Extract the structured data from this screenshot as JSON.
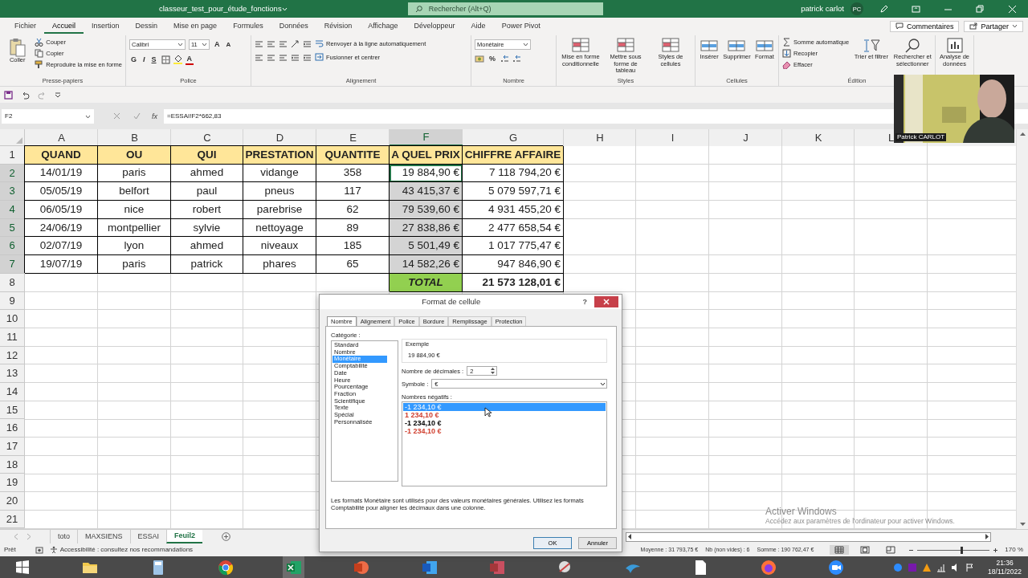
{
  "title_bar": {
    "file_name": "classeur_test_pour_étude_fonctions",
    "search_placeholder": "Rechercher (Alt+Q)",
    "user_name": "patrick carlot",
    "user_initials": "PC"
  },
  "menu_tabs": [
    {
      "label": "Fichier",
      "selected": false
    },
    {
      "label": "Accueil",
      "selected": true
    },
    {
      "label": "Insertion",
      "selected": false
    },
    {
      "label": "Dessin",
      "selected": false
    },
    {
      "label": "Mise en page",
      "selected": false
    },
    {
      "label": "Formules",
      "selected": false
    },
    {
      "label": "Données",
      "selected": false
    },
    {
      "label": "Révision",
      "selected": false
    },
    {
      "label": "Affichage",
      "selected": false
    },
    {
      "label": "Développeur",
      "selected": false
    },
    {
      "label": "Aide",
      "selected": false
    },
    {
      "label": "Power Pivot",
      "selected": false
    }
  ],
  "comments_button": "Commentaires",
  "share_button": "Partager",
  "ribbon_groups": [
    {
      "label": "Presse-papiers",
      "items": [
        {
          "kind": "paste",
          "label": "Coller"
        },
        {
          "kind": "stack",
          "items": [
            {
              "kind": "cut",
              "label": "Couper"
            },
            {
              "kind": "copy",
              "label": "Copier"
            },
            {
              "kind": "painter",
              "label": "Reproduire la mise en forme"
            }
          ]
        }
      ]
    },
    {
      "label": "Police",
      "lines": [
        {
          "items": [
            {
              "kind": "field",
              "value": "Calibri"
            },
            {
              "kind": "field",
              "value": "11"
            },
            {
              "kind": "grow",
              "label": "A"
            },
            {
              "kind": "shrink",
              "label": "A"
            }
          ]
        },
        {
          "items": [
            {
              "kind": "bold",
              "label": "G"
            },
            {
              "kind": "italic",
              "label": "I"
            },
            {
              "kind": "underline",
              "label": "S"
            },
            {
              "kind": "border"
            },
            {
              "kind": "fill"
            },
            {
              "kind": "font_color",
              "label": "A"
            }
          ]
        }
      ]
    },
    {
      "label": "Alignement",
      "lines": [
        {
          "items": [
            {
              "kind": "align"
            },
            {
              "kind": "align"
            },
            {
              "kind": "align"
            },
            {
              "kind": "orient"
            },
            {
              "kind": "indent"
            },
            {
              "kind": "wrap",
              "label": "Renvoyer à la ligne automatiquement"
            }
          ]
        },
        {
          "items": [
            {
              "kind": "align"
            },
            {
              "kind": "align"
            },
            {
              "kind": "align"
            },
            {
              "kind": "indent"
            },
            {
              "kind": "indent"
            },
            {
              "kind": "merge",
              "label": "Fusionner et centrer"
            }
          ]
        }
      ]
    },
    {
      "label": "Nombre",
      "lines": [
        {
          "items": [
            {
              "kind": "field",
              "value": "Monétaire"
            }
          ]
        },
        {
          "items": [
            {
              "kind": "accounting"
            },
            {
              "kind": "percent",
              "label": "%"
            },
            {
              "kind": "decimal"
            },
            {
              "kind": "decimal"
            }
          ]
        }
      ]
    },
    {
      "label": "Styles",
      "items": [
        {
          "kind": "style",
          "label": "Mise en forme conditionnelle"
        },
        {
          "kind": "style",
          "label": "Mettre sous forme de tableau"
        },
        {
          "kind": "style",
          "label": "Styles de cellules"
        }
      ]
    },
    {
      "label": "Cellules",
      "items": [
        {
          "kind": "cells",
          "label": "Insérer"
        },
        {
          "kind": "cells",
          "label": "Supprimer"
        },
        {
          "kind": "cells",
          "label": "Format"
        }
      ]
    },
    {
      "label": "Édition",
      "items": [
        {
          "kind": "stack",
          "items": [
            {
              "kind": "sum",
              "label": "Somme automatique"
            },
            {
              "kind": "filldown",
              "label": "Recopier"
            },
            {
              "kind": "clear",
              "label": "Effacer"
            }
          ]
        },
        {
          "kind": "sort",
          "label": "Trier et filtrer"
        },
        {
          "kind": "find",
          "label": "Rechercher et sélectionner"
        }
      ]
    },
    {
      "items": [
        {
          "kind": "analyze",
          "label": "Analyse de données"
        }
      ]
    }
  ],
  "name_box": "F2",
  "formula_label": "fx",
  "formula": "=ESSAI!F2*662,83",
  "sheet": {
    "columns": [
      {
        "label": "A",
        "selected": false
      },
      {
        "label": "B",
        "selected": false
      },
      {
        "label": "C",
        "selected": false
      },
      {
        "label": "D",
        "selected": false
      },
      {
        "label": "E",
        "selected": false
      },
      {
        "label": "F",
        "selected": true
      },
      {
        "label": "G",
        "selected": false
      },
      {
        "label": "H",
        "selected": false
      },
      {
        "label": "I",
        "selected": false
      },
      {
        "label": "J",
        "selected": false
      },
      {
        "label": "K",
        "selected": false
      },
      {
        "label": "L",
        "selected": false
      }
    ],
    "rows": [
      {
        "number": "1",
        "kind": "header",
        "selected": false,
        "cells": [
          "QUAND",
          "OU",
          "QUI",
          "PRESTATION",
          "QUANTITE",
          "A QUEL PRIX",
          "CHIFFRE AFFAIRE"
        ]
      },
      {
        "number": "2",
        "kind": "data",
        "selected": true,
        "cells": [
          "14/01/19",
          "paris",
          "ahmed",
          "vidange",
          "358",
          "19 884,90 €",
          "7 118 794,20 €"
        ]
      },
      {
        "number": "3",
        "kind": "data",
        "selected": true,
        "cells": [
          "05/05/19",
          "belfort",
          "paul",
          "pneus",
          "117",
          "43 415,37 €",
          "5 079 597,71 €"
        ]
      },
      {
        "number": "4",
        "kind": "data",
        "selected": true,
        "cells": [
          "06/05/19",
          "nice",
          "robert",
          "parebrise",
          "62",
          "79 539,60 €",
          "4 931 455,20 €"
        ]
      },
      {
        "number": "5",
        "kind": "data",
        "selected": true,
        "cells": [
          "24/06/19",
          "montpellier",
          "sylvie",
          "nettoyage",
          "89",
          "27 838,86 €",
          "2 477 658,54 €"
        ]
      },
      {
        "number": "6",
        "kind": "data",
        "selected": true,
        "cells": [
          "02/07/19",
          "lyon",
          "ahmed",
          "niveaux",
          "185",
          "5 501,49 €",
          "1 017 775,47 €"
        ]
      },
      {
        "number": "7",
        "kind": "data",
        "selected": true,
        "cells": [
          "19/07/19",
          "paris",
          "patrick",
          "phares",
          "65",
          "14 582,26 €",
          "947 846,90 €"
        ]
      },
      {
        "number": "8",
        "kind": "total",
        "selected": false,
        "label": "TOTAL",
        "value": "21 573 128,01 €"
      },
      {
        "number": "9",
        "kind": "empty",
        "selected": false
      },
      {
        "number": "10",
        "kind": "empty",
        "selected": false
      },
      {
        "number": "11",
        "kind": "empty",
        "selected": false
      },
      {
        "number": "12",
        "kind": "empty",
        "selected": false
      },
      {
        "number": "13",
        "kind": "empty",
        "selected": false
      },
      {
        "number": "14",
        "kind": "empty",
        "selected": false
      },
      {
        "number": "15",
        "kind": "empty",
        "selected": false
      },
      {
        "number": "16",
        "kind": "empty",
        "selected": false
      },
      {
        "number": "17",
        "kind": "empty",
        "selected": false
      },
      {
        "number": "18",
        "kind": "empty",
        "selected": false
      },
      {
        "number": "19",
        "kind": "empty",
        "selected": false
      },
      {
        "number": "20",
        "kind": "empty",
        "selected": false
      },
      {
        "number": "21",
        "kind": "empty",
        "selected": false
      }
    ]
  },
  "dialog": {
    "title": "Format de cellule",
    "help": "?",
    "tabs": [
      {
        "label": "Nombre",
        "selected": true
      },
      {
        "label": "Alignement",
        "selected": false
      },
      {
        "label": "Police",
        "selected": false
      },
      {
        "label": "Bordure",
        "selected": false
      },
      {
        "label": "Remplissage",
        "selected": false
      },
      {
        "label": "Protection",
        "selected": false
      }
    ],
    "category_label": "Catégorie :",
    "categories": [
      {
        "label": "Standard",
        "selected": false
      },
      {
        "label": "Nombre",
        "selected": false
      },
      {
        "label": "Monétaire",
        "selected": true
      },
      {
        "label": "Comptabilité",
        "selected": false
      },
      {
        "label": "Date",
        "selected": false
      },
      {
        "label": "Heure",
        "selected": false
      },
      {
        "label": "Pourcentage",
        "selected": false
      },
      {
        "label": "Fraction",
        "selected": false
      },
      {
        "label": "Scientifique",
        "selected": false
      },
      {
        "label": "Texte",
        "selected": false
      },
      {
        "label": "Spécial",
        "selected": false
      },
      {
        "label": "Personnalisée",
        "selected": false
      }
    ],
    "sample_label": "Exemple",
    "sample": "19 884,90 €",
    "decimals_label": "Nombre de décimales :",
    "decimals": "2",
    "symbol_label": "Symbole :",
    "symbol": "€",
    "negatives_label": "Nombres négatifs :",
    "negatives": [
      {
        "label": "-1 234,10 €",
        "selected": true
      },
      {
        "label": "1 234,10 €",
        "color": "#d04030",
        "selected": false
      },
      {
        "label": "-1 234,10 €",
        "color": "#000000",
        "selected": false
      },
      {
        "label": "-1 234,10 €",
        "color": "#d04030",
        "selected": false
      }
    ],
    "description": "Les formats Monétaire sont utilisés pour des valeurs monétaires générales. Utilisez les formats Comptabilité pour aligner les décimaux dans une colonne.",
    "buttons": [
      {
        "label": "OK",
        "kind": "confirm"
      },
      {
        "label": "Annuler",
        "kind": "cancel"
      }
    ]
  },
  "sheet_tabs": [
    {
      "label": "toto",
      "selected": false
    },
    {
      "label": "MAXSIENS",
      "selected": false
    },
    {
      "label": "ESSAI",
      "selected": false
    },
    {
      "label": "Feuil2",
      "selected": true
    }
  ],
  "status_bar": {
    "status": "Prêt",
    "accessibility": "Accessibilité : consultez nos recommandations",
    "stats": [
      "Moyenne : 31 793,75 €",
      "Nb (non vides) : 6",
      "Somme : 190 762,47 €"
    ],
    "views": [
      {
        "kind": "normal",
        "selected": true
      },
      {
        "kind": "page_layout",
        "selected": false
      },
      {
        "kind": "page_break",
        "selected": false
      }
    ],
    "zoom": {
      "level": 0.6,
      "reading": "170 %"
    }
  },
  "webcam": {
    "kind": "picture",
    "caption": "Patrick CARLOT"
  },
  "watermark": {
    "title": "Activer Windows",
    "text": "Accédez aux paramètres de l'ordinateur pour activer Windows."
  },
  "taskbar": {
    "apps": [
      {
        "kind": "start",
        "selected": false
      },
      {
        "kind": "folder",
        "selected": false
      },
      {
        "kind": "calculator",
        "selected": false
      },
      {
        "kind": "browser",
        "selected": false
      },
      {
        "kind": "spreadsheet",
        "selected": true
      },
      {
        "kind": "slides",
        "selected": false
      },
      {
        "kind": "document",
        "selected": false
      },
      {
        "kind": "database",
        "selected": false
      },
      {
        "kind": "tool",
        "selected": false
      },
      {
        "kind": "writer",
        "selected": false
      },
      {
        "kind": "file",
        "selected": false
      },
      {
        "kind": "firefox",
        "selected": false
      },
      {
        "kind": "meeting",
        "selected": false
      }
    ],
    "time": "21:36",
    "date": "18/11/2022"
  }
}
